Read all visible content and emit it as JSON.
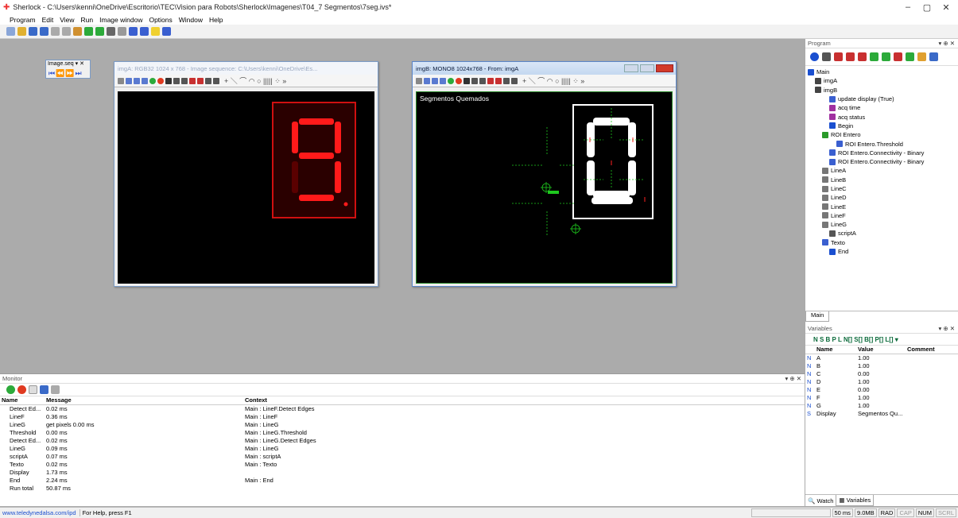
{
  "title": "Sherlock - C:\\Users\\kenni\\OneDrive\\Escritorio\\TEC\\Vision para Robots\\Sherlock\\Imagenes\\T04_7 Segmentos\\7seg.ivs*",
  "menu": [
    "Program",
    "Edit",
    "View",
    "Run",
    "Image window",
    "Options",
    "Window",
    "Help"
  ],
  "imageseq": {
    "title": "Image.seq ▾ ✕"
  },
  "imgA": {
    "caption": "imgA: RGB32 1024 x 768 - Image sequence: C:\\Users\\kenni\\OneDrive\\Es..."
  },
  "imgB": {
    "caption": "imgB: MONO8 1024x768 - From: imgA",
    "overlay": "Segmentos Quemados"
  },
  "program": {
    "title": "Program",
    "tree": [
      {
        "label": "Main",
        "indent": 0,
        "color": "#1a4fd0"
      },
      {
        "label": "imgA",
        "indent": 1,
        "color": "#444"
      },
      {
        "label": "imgB",
        "indent": 1,
        "color": "#444"
      },
      {
        "label": "update display (True)",
        "indent": 3,
        "color": "#3a5fd0"
      },
      {
        "label": "acq time",
        "indent": 3,
        "color": "#a030a0"
      },
      {
        "label": "acq status",
        "indent": 3,
        "color": "#a030a0"
      },
      {
        "label": "Begin",
        "indent": 3,
        "color": "#1a4fd0"
      },
      {
        "label": "ROI Entero",
        "indent": 2,
        "color": "#2a9a2a"
      },
      {
        "label": "ROI Entero.Threshold",
        "indent": 4,
        "color": "#3a5fd0"
      },
      {
        "label": "ROI Entero.Connectivity - Binary",
        "indent": 3,
        "color": "#3a5fd0"
      },
      {
        "label": "ROI Entero.Connectivity - Binary",
        "indent": 3,
        "color": "#3a5fd0"
      },
      {
        "label": "LineA",
        "indent": 2,
        "color": "#777"
      },
      {
        "label": "LineB",
        "indent": 2,
        "color": "#777"
      },
      {
        "label": "LineC",
        "indent": 2,
        "color": "#777"
      },
      {
        "label": "LineD",
        "indent": 2,
        "color": "#777"
      },
      {
        "label": "LineE",
        "indent": 2,
        "color": "#777"
      },
      {
        "label": "LineF",
        "indent": 2,
        "color": "#777"
      },
      {
        "label": "LineG",
        "indent": 2,
        "color": "#777"
      },
      {
        "label": "scriptA",
        "indent": 3,
        "color": "#555"
      },
      {
        "label": "Texto",
        "indent": 2,
        "color": "#3a5fd0"
      },
      {
        "label": "End",
        "indent": 3,
        "color": "#1a4fd0"
      }
    ],
    "tab": "Main"
  },
  "variables": {
    "title": "Variables",
    "toolbar": "N  S  B  P  L  N[] S[] B[] P[] L[] ▾",
    "headers": [
      "Name",
      "Value",
      "Comment"
    ],
    "rows": [
      [
        "N",
        "A",
        "1.00"
      ],
      [
        "N",
        "B",
        "1.00"
      ],
      [
        "N",
        "C",
        "0.00"
      ],
      [
        "N",
        "D",
        "1.00"
      ],
      [
        "N",
        "E",
        "0.00"
      ],
      [
        "N",
        "F",
        "1.00"
      ],
      [
        "N",
        "G",
        "1.00"
      ],
      [
        "S",
        "Display",
        "Segmentos Qu..."
      ]
    ],
    "tabs": [
      "Watch",
      "Variables"
    ]
  },
  "monitor": {
    "title": "Monitor",
    "headers": [
      "Name",
      "Message",
      "Context"
    ],
    "rows": [
      [
        "Detect Ed...",
        "0.02 ms",
        "Main : LineF.Detect Edges"
      ],
      [
        "LineF",
        "0.36 ms",
        "Main : LineF"
      ],
      [
        "LineG",
        "get pixels 0.00 ms",
        "Main : LineG"
      ],
      [
        "Threshold",
        "0.00 ms",
        "Main : LineG.Threshold"
      ],
      [
        "Detect Ed...",
        "0.02 ms",
        "Main : LineG.Detect Edges"
      ],
      [
        "LineG",
        "0.09 ms",
        "Main : LineG"
      ],
      [
        "scriptA",
        "0.07 ms",
        "Main : scriptA"
      ],
      [
        "Texto",
        "0.02 ms",
        "Main : Texto"
      ],
      [
        "Display",
        "1.73 ms",
        ""
      ],
      [
        "End",
        "2.24 ms",
        "Main : End"
      ],
      [
        "Run total",
        "50.87 ms",
        ""
      ]
    ]
  },
  "status": {
    "link": "www.teledynedalsa.com/ipd",
    "help": "For Help, press F1",
    "time": "50 ms",
    "mem": "9.0MB",
    "rad": "RAD",
    "cap": "CAP",
    "num": "NUM",
    "scrl": "SCRL"
  }
}
